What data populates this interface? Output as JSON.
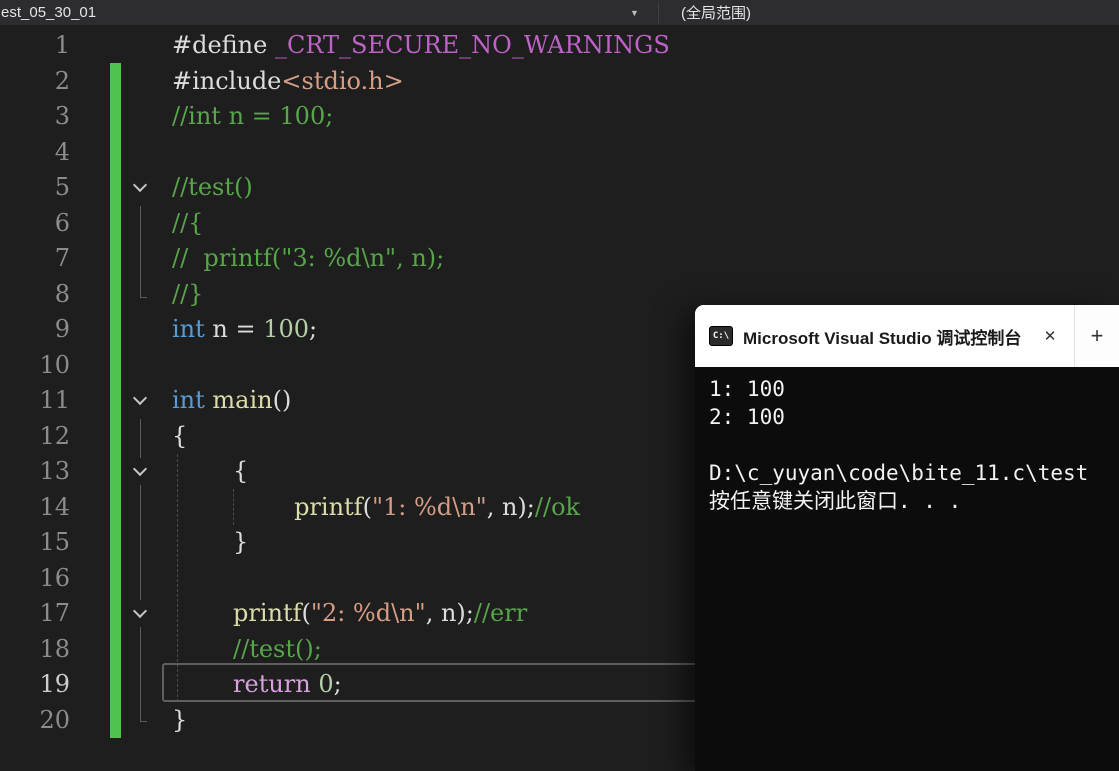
{
  "navbar": {
    "member_dropdown": "est_05_30_01",
    "scope_dropdown": "(全局范围)"
  },
  "icons": {
    "dropdown_arrow": "▼",
    "close": "✕",
    "new_tab": "+",
    "console_icon": "C:\\"
  },
  "editor": {
    "current_line": "19",
    "modified_lines_start": 2,
    "modified_lines_end": 20,
    "folded_rows": [
      5,
      11,
      13,
      17
    ],
    "lines": [
      {
        "num": "1",
        "tokens": [
          {
            "t": "#define ",
            "c": "def"
          },
          {
            "t": "_CRT_SECURE_NO_WARNINGS",
            "c": "macro"
          }
        ]
      },
      {
        "num": "2",
        "tokens": [
          {
            "t": "#include",
            "c": "def"
          },
          {
            "t": "<stdio.h>",
            "c": "str"
          }
        ]
      },
      {
        "num": "3",
        "tokens": [
          {
            "t": "//int n = 100;",
            "c": "com"
          }
        ]
      },
      {
        "num": "4",
        "tokens": []
      },
      {
        "num": "5",
        "fold": true,
        "tokens": [
          {
            "t": "//test()",
            "c": "com"
          }
        ]
      },
      {
        "num": "6",
        "tokens": [
          {
            "t": "//{",
            "c": "com"
          }
        ]
      },
      {
        "num": "7",
        "tokens": [
          {
            "t": "//  printf(\"3: %d\\n\", n);",
            "c": "com"
          }
        ]
      },
      {
        "num": "8",
        "tokens": [
          {
            "t": "//}",
            "c": "com"
          }
        ]
      },
      {
        "num": "9",
        "tokens": [
          {
            "t": "int",
            "c": "kw"
          },
          {
            "t": " n = ",
            "c": "def"
          },
          {
            "t": "100",
            "c": "num"
          },
          {
            "t": ";",
            "c": "def"
          }
        ]
      },
      {
        "num": "10",
        "tokens": []
      },
      {
        "num": "11",
        "fold": true,
        "tokens": [
          {
            "t": "int",
            "c": "kw"
          },
          {
            "t": " ",
            "c": "def"
          },
          {
            "t": "main",
            "c": "fn"
          },
          {
            "t": "()",
            "c": "def"
          }
        ]
      },
      {
        "num": "12",
        "tokens": [
          {
            "t": "{",
            "c": "def"
          }
        ]
      },
      {
        "num": "13",
        "fold": true,
        "tokens": [
          {
            "t": "        {",
            "c": "def"
          }
        ]
      },
      {
        "num": "14",
        "tokens": [
          {
            "t": "                ",
            "c": "def"
          },
          {
            "t": "printf",
            "c": "fn"
          },
          {
            "t": "(",
            "c": "def"
          },
          {
            "t": "\"1: %d\\n\"",
            "c": "str"
          },
          {
            "t": ", n);",
            "c": "def"
          },
          {
            "t": "//ok",
            "c": "com"
          }
        ]
      },
      {
        "num": "15",
        "tokens": [
          {
            "t": "        }",
            "c": "def"
          }
        ]
      },
      {
        "num": "16",
        "tokens": []
      },
      {
        "num": "17",
        "fold": true,
        "tokens": [
          {
            "t": "        ",
            "c": "def"
          },
          {
            "t": "printf",
            "c": "fn"
          },
          {
            "t": "(",
            "c": "def"
          },
          {
            "t": "\"2: %d\\n\"",
            "c": "str"
          },
          {
            "t": ", n);",
            "c": "def"
          },
          {
            "t": "//err",
            "c": "com"
          }
        ]
      },
      {
        "num": "18",
        "tokens": [
          {
            "t": "        ",
            "c": "def"
          },
          {
            "t": "//test();",
            "c": "com"
          }
        ]
      },
      {
        "num": "19",
        "tokens": [
          {
            "t": "        ",
            "c": "def"
          },
          {
            "t": "return",
            "c": "ctrl"
          },
          {
            "t": " ",
            "c": "def"
          },
          {
            "t": "0",
            "c": "num"
          },
          {
            "t": ";",
            "c": "def"
          }
        ]
      },
      {
        "num": "20",
        "tokens": [
          {
            "t": "}",
            "c": "def"
          }
        ]
      }
    ],
    "colors": {
      "keyword": "#569CD6",
      "macro": "#BD63C5",
      "string": "#D69D85",
      "comment": "#57A64A",
      "number": "#B5CEA8",
      "function": "#DCDCAA",
      "control": "#D8A0DF",
      "modified_indicator": "#50C24E"
    }
  },
  "console": {
    "title": "Microsoft Visual Studio 调试控制台",
    "lines": [
      "1: 100",
      "2: 100",
      "",
      "D:\\c_yuyan\\code\\bite_11.c\\test",
      "按任意键关闭此窗口. . ."
    ]
  }
}
